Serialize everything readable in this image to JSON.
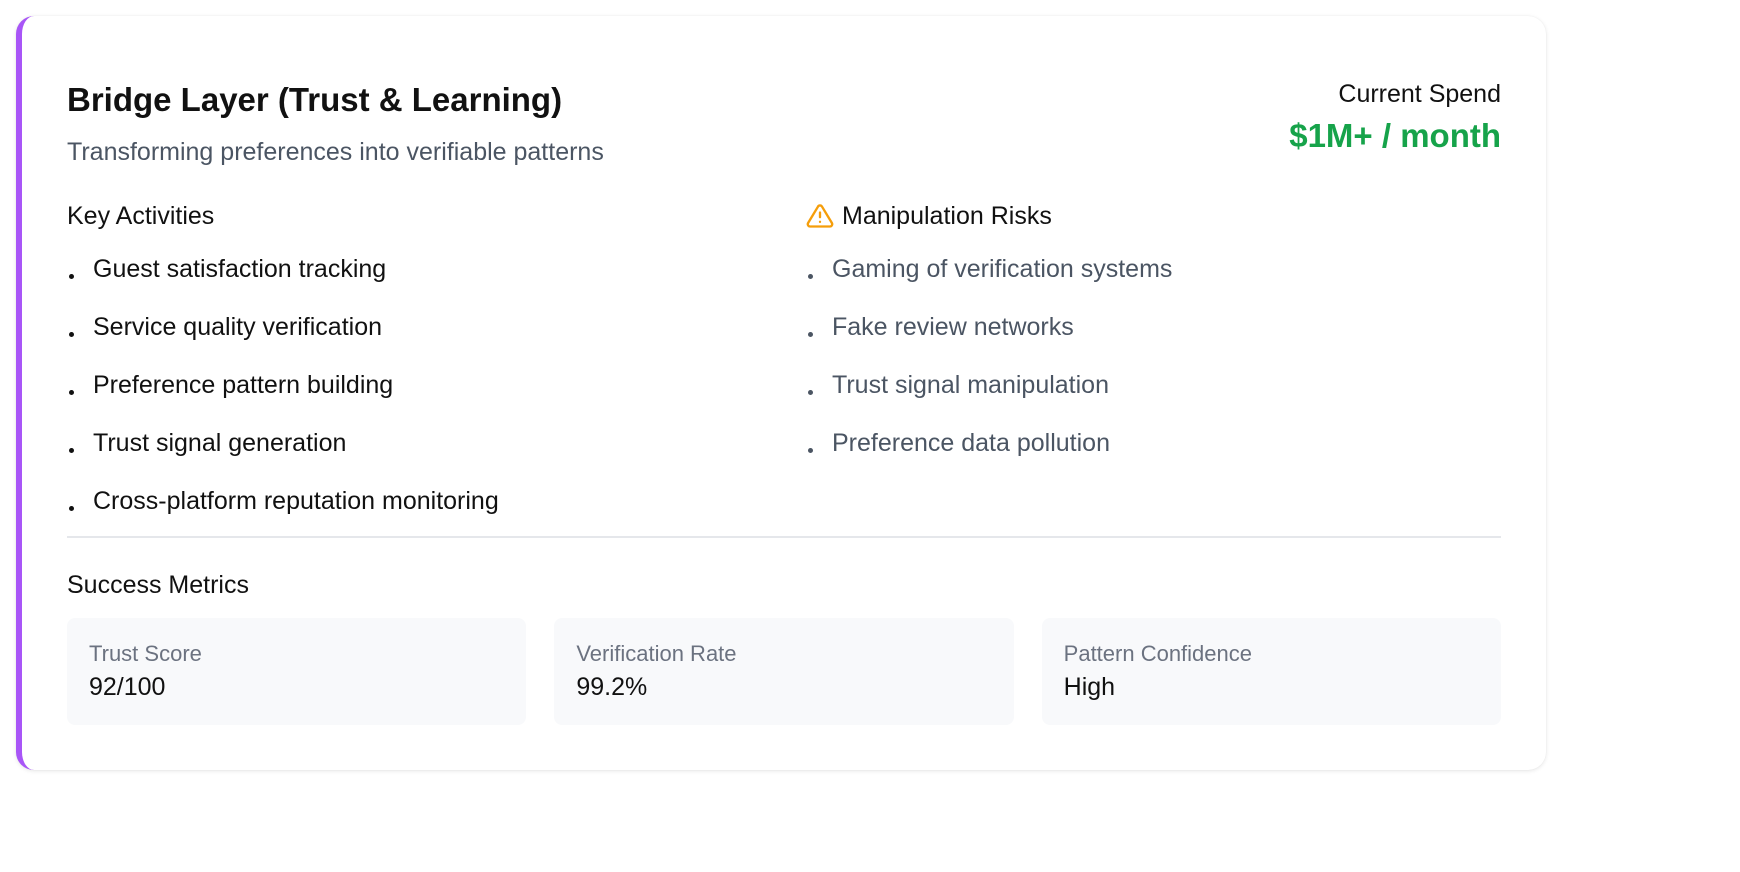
{
  "header": {
    "title": "Bridge Layer (Trust & Learning)",
    "subtitle": "Transforming preferences into verifiable patterns"
  },
  "spend": {
    "label": "Current Spend",
    "value": "$1M+ / month"
  },
  "key_activities": {
    "title": "Key Activities",
    "items": [
      "Guest satisfaction tracking",
      "Service quality verification",
      "Preference pattern building",
      "Trust signal generation",
      "Cross-platform reputation monitoring"
    ]
  },
  "risks": {
    "title": "Manipulation Risks",
    "icon": "warning-triangle-icon",
    "items": [
      "Gaming of verification systems",
      "Fake review networks",
      "Trust signal manipulation",
      "Preference data pollution"
    ]
  },
  "metrics": {
    "title": "Success Metrics",
    "items": [
      {
        "label": "Trust Score",
        "value": "92/100"
      },
      {
        "label": "Verification Rate",
        "value": "99.2%"
      },
      {
        "label": "Pattern Confidence",
        "value": "High"
      }
    ]
  },
  "colors": {
    "accent": "#a855f7",
    "spend": "#16a34a",
    "warning": "#f59e0b"
  }
}
